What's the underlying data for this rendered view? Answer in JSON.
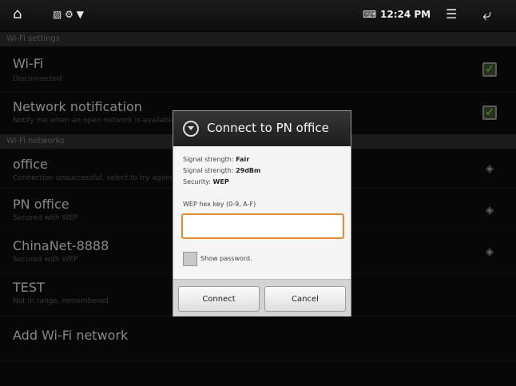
{
  "statusbar": {
    "time": "12:24 PM"
  },
  "sections": {
    "settings": "Wi-Fi settings",
    "networks": "Wi-Fi networks"
  },
  "rows": {
    "wifi": {
      "title": "Wi-Fi",
      "subtitle": "Disconnected"
    },
    "notification": {
      "title": "Network notification",
      "subtitle": "Notify me when an open network is available"
    },
    "office": {
      "title": "office",
      "subtitle": "Connection unsuccessful, select to try again"
    },
    "pn_office": {
      "title": "PN office",
      "subtitle": "Secured with WEP"
    },
    "chinanet": {
      "title": "ChinaNet-8888",
      "subtitle": "Secured with WEP"
    },
    "test": {
      "title": "TEST",
      "subtitle": "Not in range, remembered"
    },
    "add": {
      "title": "Add Wi-Fi network"
    }
  },
  "dialog": {
    "title": "Connect to PN office",
    "signal_strength_label": "Signal strength",
    "signal_strength_value": "Fair",
    "signal_strength_label2": "Signal strength",
    "signal_strength_value2": "29dBm",
    "security_label": "Security",
    "security_value": "WEP",
    "field_label": "WEP hex key (0-9, A-F)",
    "field_value": "",
    "show_password_label": "Show password.",
    "connect_label": "Connect",
    "cancel_label": "Cancel"
  }
}
